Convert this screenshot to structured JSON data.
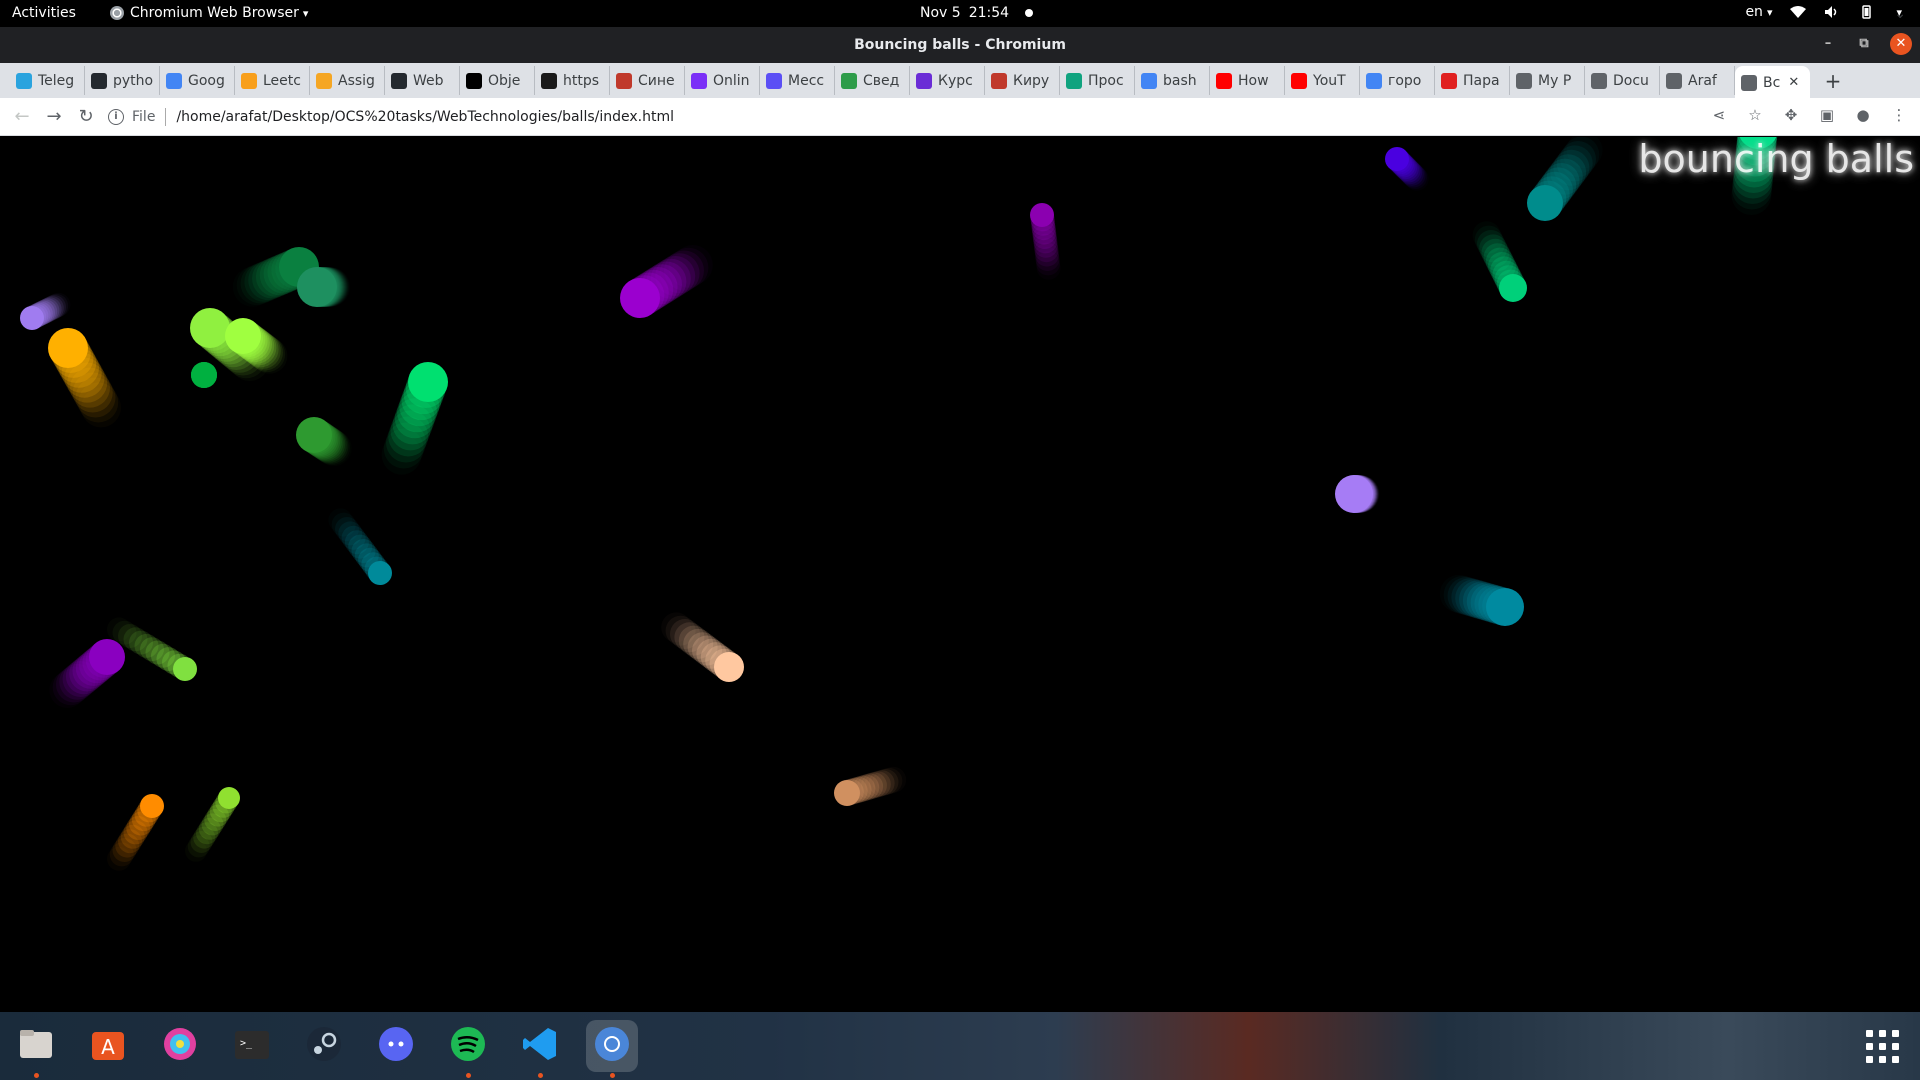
{
  "topbar": {
    "activities": "Activities",
    "app_name": "Chromium Web Browser",
    "date": "Nov 5",
    "time": "21:54",
    "language": "en"
  },
  "window": {
    "title": "Bouncing balls - Chromium"
  },
  "tabs": [
    {
      "label": "Teleg",
      "favicon_color": "#2aa3de"
    },
    {
      "label": "pytho",
      "favicon_color": "#24292f"
    },
    {
      "label": "Goog",
      "favicon_color": "#4285f4"
    },
    {
      "label": "Leetc",
      "favicon_color": "#f89f1b"
    },
    {
      "label": "Assig",
      "favicon_color": "#f5a623"
    },
    {
      "label": "Web",
      "favicon_color": "#24292f"
    },
    {
      "label": "Obje",
      "favicon_color": "#000000"
    },
    {
      "label": "https",
      "favicon_color": "#1a1a1a"
    },
    {
      "label": "Сине",
      "favicon_color": "#c0392b"
    },
    {
      "label": "Onlin",
      "favicon_color": "#7b2ff7"
    },
    {
      "label": "Месс",
      "favicon_color": "#5b4ff5"
    },
    {
      "label": "Свед",
      "favicon_color": "#2e9c4a"
    },
    {
      "label": "Курс",
      "favicon_color": "#6a2cd6"
    },
    {
      "label": "Киру",
      "favicon_color": "#c0392b"
    },
    {
      "label": "Прос",
      "favicon_color": "#10a37f"
    },
    {
      "label": "bash",
      "favicon_color": "#4285f4"
    },
    {
      "label": "How",
      "favicon_color": "#ff0000"
    },
    {
      "label": "YouT",
      "favicon_color": "#ff0000"
    },
    {
      "label": "горо",
      "favicon_color": "#4285f4"
    },
    {
      "label": "Пара",
      "favicon_color": "#e02020"
    },
    {
      "label": "My P",
      "favicon_color": "#5f6368"
    },
    {
      "label": "Docu",
      "favicon_color": "#5f6368"
    },
    {
      "label": "Araf",
      "favicon_color": "#5f6368"
    },
    {
      "label": "Bc",
      "favicon_color": "#5f6368",
      "active": true
    }
  ],
  "toolbar": {
    "file_label": "File",
    "url": "/home/arafat/Desktop/OCS%20tasks/WebTechnologies/balls/index.html"
  },
  "page": {
    "heading": "bouncing balls"
  },
  "balls": [
    {
      "color": "#8b00b0",
      "dir": [
        -1,
        -8
      ]
    },
    {
      "color": "#4a00e0",
      "dir": [
        -3,
        -3
      ]
    },
    {
      "color": "#008c8c",
      "dir": [
        -6,
        8
      ]
    },
    {
      "color": "#00e08a",
      "dir": [
        1,
        -10
      ]
    },
    {
      "color": "#00d07a",
      "dir": [
        4,
        8
      ]
    },
    {
      "color": "#ffb000",
      "dir": [
        -5,
        -9
      ]
    },
    {
      "color": "#a07cf0",
      "dir": [
        -4,
        2
      ]
    },
    {
      "color": "#0a8040",
      "dir": [
        7,
        -3
      ]
    },
    {
      "color": "#1e9060",
      "dir": [
        -2,
        0
      ]
    },
    {
      "color": "#90f040",
      "dir": [
        -6,
        -5
      ]
    },
    {
      "color": "#a0ff40",
      "dir": [
        -4,
        -3
      ]
    },
    {
      "color": "#00b040",
      "dir": [
        0,
        0
      ]
    },
    {
      "color": "#9b00cf",
      "dir": [
        -8,
        5
      ]
    },
    {
      "color": "#00e070",
      "dir": [
        4,
        -11
      ]
    },
    {
      "color": "#2e9a30",
      "dir": [
        -3,
        -2
      ]
    },
    {
      "color": "#a67cf5",
      "dir": [
        -1,
        0
      ]
    },
    {
      "color": "#008aa0",
      "dir": [
        7,
        2
      ]
    },
    {
      "color": "#008a9a",
      "dir": [
        6,
        8
      ]
    },
    {
      "color": "#8a00c0",
      "dir": [
        6,
        -5
      ]
    },
    {
      "color": "#80e040",
      "dir": [
        10,
        6
      ]
    },
    {
      "color": "#ffc8a0",
      "dir": [
        8,
        6
      ]
    },
    {
      "color": "#ff8c00",
      "dir": [
        5,
        -8
      ]
    },
    {
      "color": "#90e030",
      "dir": [
        5,
        -8
      ]
    },
    {
      "color": "#d09060",
      "dir": [
        -7,
        2
      ]
    }
  ],
  "dock": [
    {
      "name": "files"
    },
    {
      "name": "software-center"
    },
    {
      "name": "color-picker"
    },
    {
      "name": "terminal"
    },
    {
      "name": "steam"
    },
    {
      "name": "discord"
    },
    {
      "name": "spotify"
    },
    {
      "name": "vscode"
    },
    {
      "name": "chromium"
    }
  ]
}
